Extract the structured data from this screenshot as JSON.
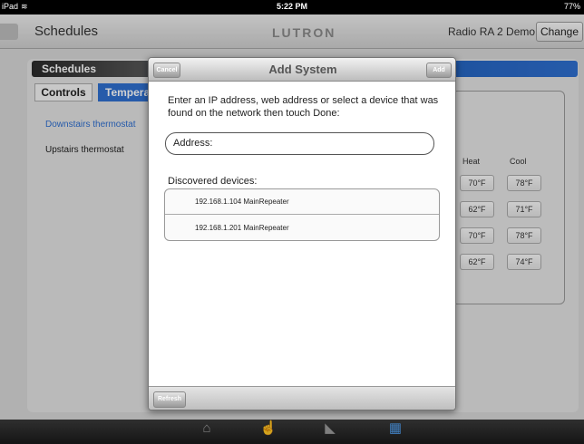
{
  "status_bar": {
    "device": "iPad",
    "time": "5:22 PM",
    "battery": "77%"
  },
  "nav": {
    "title": "Schedules",
    "logo": "LUTRON",
    "system_name": "Radio RA 2 Demo",
    "change_label": "Change"
  },
  "background": {
    "section_title": "Schedules",
    "tabs": [
      "Controls",
      "Temperat"
    ],
    "thermostats": [
      "Downstairs thermostat",
      "Upstairs thermostat"
    ],
    "columns": {
      "heat": "Heat",
      "cool": "Cool"
    },
    "rows": [
      {
        "heat": "70°F",
        "cool": "78°F"
      },
      {
        "heat": "62°F",
        "cool": "71°F"
      },
      {
        "heat": "70°F",
        "cool": "78°F"
      },
      {
        "heat": "62°F",
        "cool": "74°F"
      }
    ]
  },
  "modal": {
    "title": "Add System",
    "cancel_label": "Cancel",
    "add_label": "Add",
    "instructions": "Enter an IP address, web address or select a device that was found on the network then touch Done:",
    "address_label": "Address:",
    "discovered_label": "Discovered devices:",
    "devices": [
      {
        "label": "192.168.1.104  MainRepeater"
      },
      {
        "label": "192.168.1.201  MainRepeater"
      }
    ],
    "refresh_label": "Refresh"
  },
  "tab_bar": {
    "active_index": 3
  },
  "colors": {
    "accent": "#2f6fd0",
    "tab_active": "#4f9ae8"
  }
}
